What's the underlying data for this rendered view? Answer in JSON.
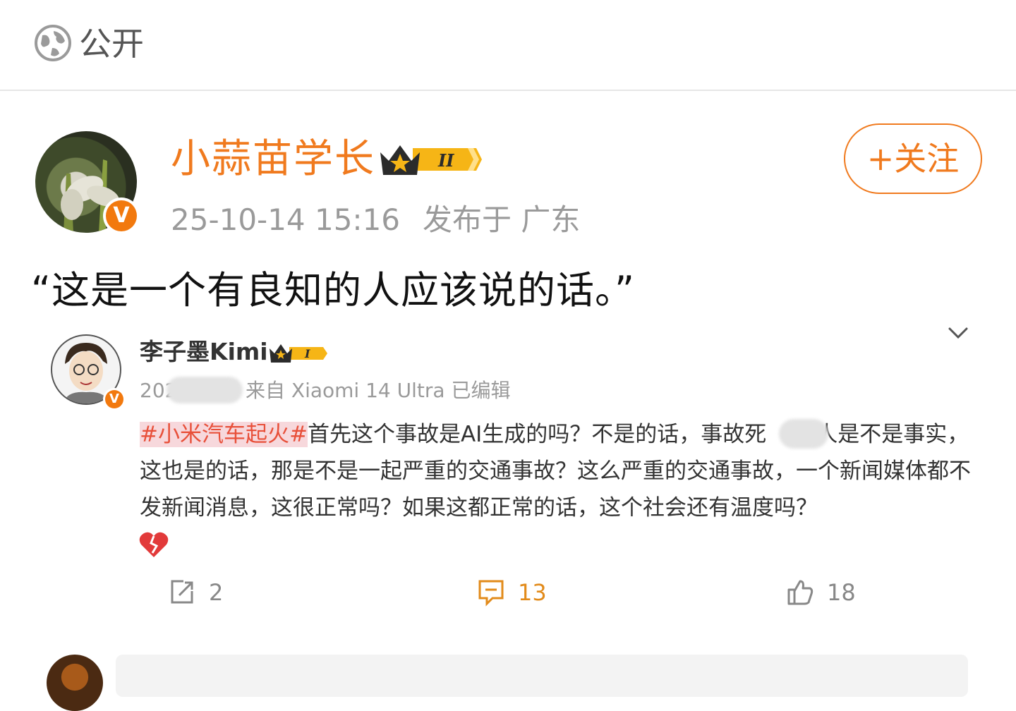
{
  "visibility": {
    "icon": "globe-icon",
    "label": "公开"
  },
  "author": {
    "name": "小蒜苗学长",
    "verified_badge": "V",
    "level_badge": "II",
    "time": "25-10-14 15:16",
    "location": "发布于 广东",
    "follow_label": "+关注"
  },
  "post": {
    "text": "“这是一个有良知的人应该说的话。”"
  },
  "embedded": {
    "user_name": "李子墨Kimi",
    "verified_badge": "V",
    "level_badge": "I",
    "time_partial": "202",
    "source": "来自 Xiaomi 14 Ultra 已编辑",
    "tag": "#小米汽车起火#",
    "text_part1": "首先这个事故是AI生成的吗？不是的话，事故死",
    "text_part2": "人是不是事实，这也是的话，那是不是一起严重的交通事故？这么严重的交通事故，一个新闻媒体都不发新闻消息，这很正常吗？如果这都正常的话，这个社会还有温度吗？",
    "emoji": "broken-heart-icon",
    "actions": {
      "repost_count": "2",
      "comment_count": "13",
      "like_count": "18"
    }
  },
  "colors": {
    "brand_orange": "#f07a1e",
    "tag_red": "#e8503a",
    "comment_orange": "#e28b1b",
    "meta_gray": "#9a9a9a"
  }
}
